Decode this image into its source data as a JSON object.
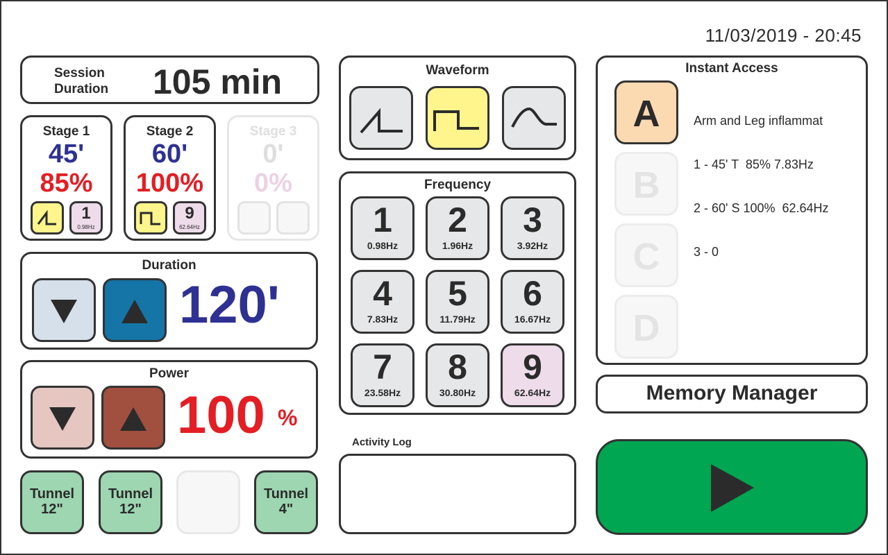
{
  "header": {
    "datetime": "11/03/2019 - 20:45"
  },
  "session": {
    "label_line1": "Session",
    "label_line2": "Duration",
    "value": "105 min"
  },
  "stages": [
    {
      "title": "Stage 1",
      "time": "45'",
      "power": "85%",
      "waveform_icon": "ramp-wave-icon",
      "freq_number": "1",
      "freq_hz": "0.98Hz",
      "enabled": true
    },
    {
      "title": "Stage 2",
      "time": "60'",
      "power": "100%",
      "waveform_icon": "square-wave-icon",
      "freq_number": "9",
      "freq_hz": "62.64Hz",
      "enabled": true
    },
    {
      "title": "Stage 3",
      "time": "0'",
      "power": "0%",
      "enabled": false
    }
  ],
  "duration": {
    "title": "Duration",
    "value": "120'",
    "down_icon": "triangle-down-icon",
    "up_icon": "triangle-up-icon"
  },
  "power": {
    "title": "Power",
    "value": "100",
    "unit": "%"
  },
  "tunnels": [
    {
      "line1": "Tunnel",
      "line2": "12\""
    },
    {
      "line1": "Tunnel",
      "line2": "12\""
    },
    {
      "line1": "",
      "line2": ""
    },
    {
      "line1": "Tunnel",
      "line2": "4\""
    }
  ],
  "waveform": {
    "title": "Waveform",
    "options": [
      "ramp-wave-icon",
      "square-wave-icon",
      "sine-wave-icon"
    ],
    "selected": "square-wave-icon"
  },
  "frequency": {
    "title": "Frequency",
    "items": [
      {
        "n": "1",
        "hz": "0.98Hz"
      },
      {
        "n": "2",
        "hz": "1.96Hz"
      },
      {
        "n": "3",
        "hz": "3.92Hz"
      },
      {
        "n": "4",
        "hz": "7.83Hz"
      },
      {
        "n": "5",
        "hz": "11.79Hz"
      },
      {
        "n": "6",
        "hz": "16.67Hz"
      },
      {
        "n": "7",
        "hz": "23.58Hz"
      },
      {
        "n": "8",
        "hz": "30.80Hz"
      },
      {
        "n": "9",
        "hz": "62.64Hz"
      }
    ],
    "selected": "9"
  },
  "activity_log": {
    "title": "Activity Log"
  },
  "instant_access": {
    "title": "Instant Access",
    "slots": [
      "A",
      "B",
      "C",
      "D"
    ],
    "active_slot": "A",
    "lines": [
      "Arm and Leg inflammat",
      "1 - 45' T  85% 7.83Hz",
      "2 - 60' S 100%  62.64Hz",
      "3 - 0"
    ]
  },
  "memory_manager": {
    "label": "Memory Manager"
  },
  "play": {
    "icon": "play-icon"
  },
  "colors": {
    "blue_value": "#2e3192",
    "red_value": "#e31e24",
    "selected_wave": "#fff58c",
    "selected_freq": "#eedcea",
    "tunnel_green": "#9dd6b1",
    "play_green": "#00a651",
    "duration_up": "#1475a6",
    "power_up": "#a14f3f"
  }
}
